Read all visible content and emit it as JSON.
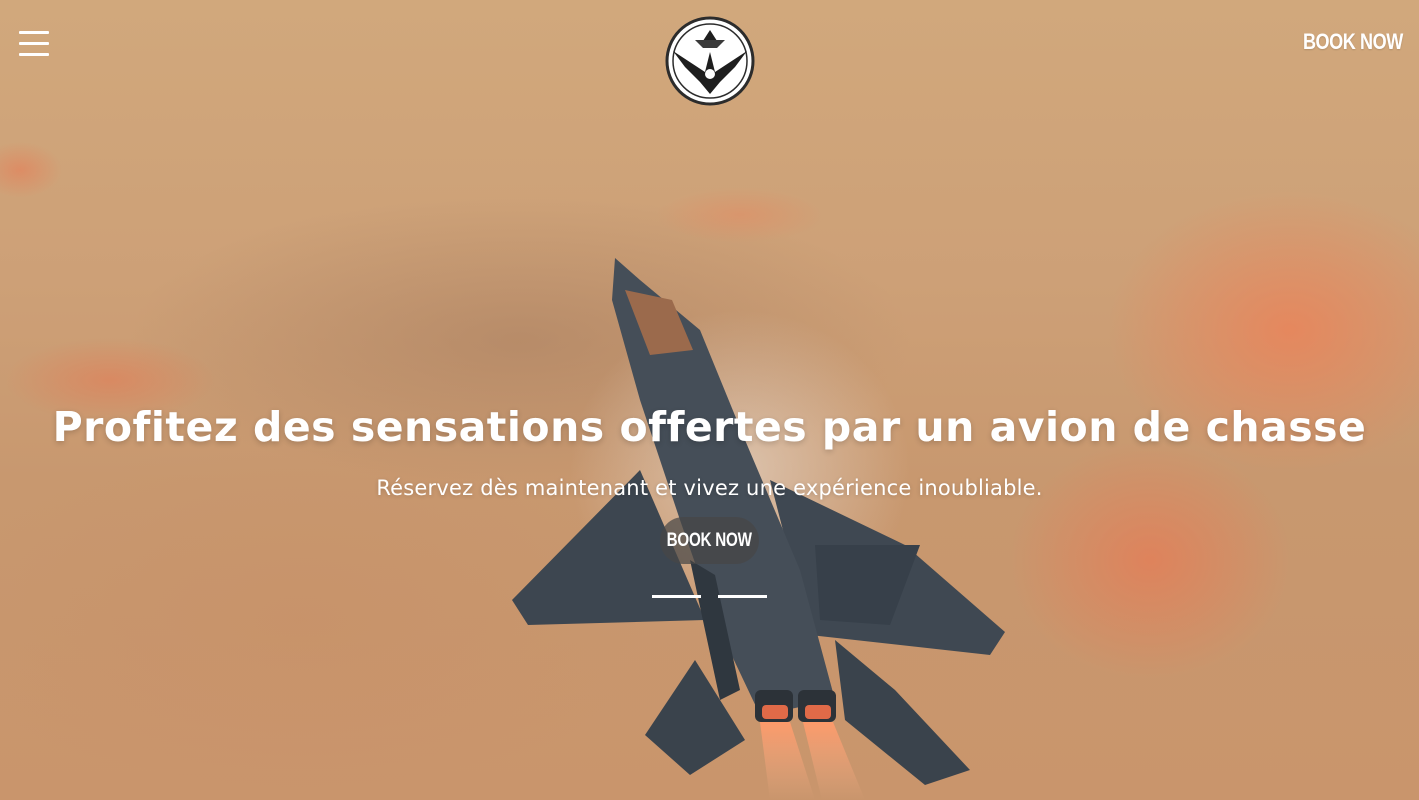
{
  "header": {
    "menu_icon": "hamburger-menu-icon",
    "logo_icon": "fighter-jet-emblem-icon",
    "book_now_label": "BOOK NOW"
  },
  "hero": {
    "title": "Profitez des sensations offertes par un avion de chasse",
    "subtitle": "Réservez dès maintenant et vivez une expérience inoubliable.",
    "cta_label": "BOOK NOW",
    "slides": [
      {
        "label": "slide 1",
        "active": true
      },
      {
        "label": "slide 2",
        "active": false
      }
    ]
  },
  "colors": {
    "sky": "#cda077",
    "cloud_accent": "#ee8056",
    "text": "#ffffff",
    "cta_background": "#464646"
  }
}
